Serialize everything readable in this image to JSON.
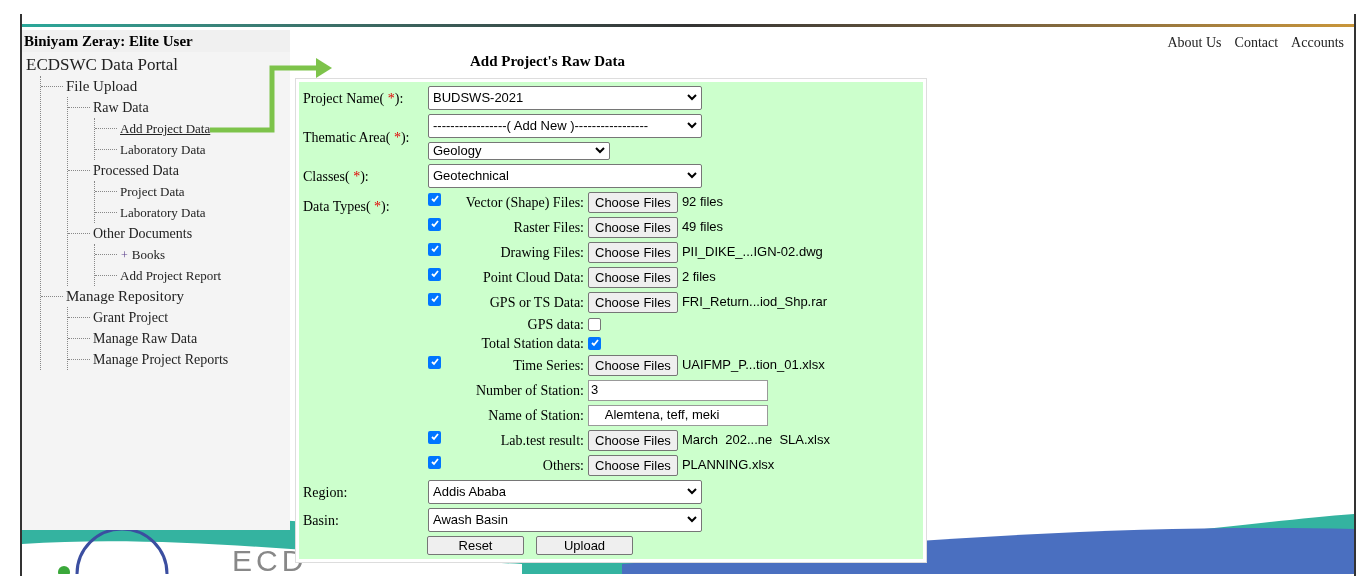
{
  "user": "Biniyam Zeray: Elite User",
  "top_links": [
    "About Us",
    "Contact",
    "Accounts"
  ],
  "tree": {
    "label": "ECDSWC Data Portal",
    "children": [
      {
        "label": "File Upload",
        "selected": false,
        "children": [
          {
            "label": "Raw Data",
            "selected": false,
            "children": [
              {
                "label": "Add Project Data",
                "selected": true
              },
              {
                "label": "Laboratory Data",
                "selected": false
              }
            ]
          },
          {
            "label": "Processed Data",
            "selected": false,
            "children": [
              {
                "label": "Project Data",
                "selected": false
              },
              {
                "label": "Laboratory Data",
                "selected": false
              }
            ]
          },
          {
            "label": "Other Documents",
            "selected": false,
            "children": [
              {
                "label": "Books",
                "selected": false,
                "expander": "+"
              },
              {
                "label": "Add Project Report",
                "selected": false
              }
            ]
          }
        ]
      },
      {
        "label": "Manage Repository",
        "selected": false,
        "children": [
          {
            "label": "Grant Project",
            "selected": false
          },
          {
            "label": "Manage Raw Data",
            "selected": false
          },
          {
            "label": "Manage Project Reports",
            "selected": false
          }
        ]
      }
    ]
  },
  "form": {
    "title": "Add Project's Raw Data",
    "project_name": {
      "label": "Project Name(",
      "required": "*",
      "label_end": "):",
      "value": "BUDSWS-2021"
    },
    "thematic_area": {
      "label": "Thematic Area(",
      "required": "*",
      "label_end": "):",
      "value": "-----------------( Add New )-----------------",
      "sub_value": "Geology"
    },
    "classes": {
      "label": "Classes(",
      "required": "*",
      "label_end": "):",
      "value": "Geotechnical"
    },
    "data_types": {
      "label": "Data Types(",
      "required": "*",
      "label_end": "):",
      "items": [
        {
          "kind": "file",
          "checked": true,
          "label": "Vector (Shape) Files:",
          "button": "Choose Files",
          "file": "92 files"
        },
        {
          "kind": "file",
          "checked": true,
          "label": "Raster Files:",
          "button": "Choose Files",
          "file": "49 files"
        },
        {
          "kind": "file",
          "checked": true,
          "label": "Drawing Files:",
          "button": "Choose Files",
          "file": "PII_DIKE_...IGN-02.dwg"
        },
        {
          "kind": "file",
          "checked": true,
          "label": "Point Cloud Data:",
          "button": "Choose Files",
          "file": "2 files"
        },
        {
          "kind": "file",
          "checked": true,
          "label": "GPS or TS Data:",
          "button": "Choose Files",
          "file": "FRI_Return...iod_Shp.rar"
        },
        {
          "kind": "check",
          "checked": false,
          "label": "GPS data:"
        },
        {
          "kind": "check",
          "checked": true,
          "label": "Total Station data:"
        },
        {
          "kind": "file",
          "checked": true,
          "label": "Time Series:",
          "button": "Choose Files",
          "file": "UAIFMP_P...tion_01.xlsx"
        },
        {
          "kind": "text",
          "label": "Number of Station:",
          "value": "3"
        },
        {
          "kind": "text",
          "label": "Name of Station:",
          "value": "    Alemtena, teff, meki"
        },
        {
          "kind": "file",
          "checked": true,
          "label": "Lab.test result:",
          "button": "Choose Files",
          "file": "March  202...ne  SLA.xlsx"
        },
        {
          "kind": "file",
          "checked": true,
          "label": "Others:",
          "button": "Choose Files",
          "file": "PLANNING.xlsx"
        }
      ]
    },
    "region": {
      "label": "Region:",
      "value": "Addis Ababa"
    },
    "basin": {
      "label": "Basin:",
      "value": "Awash Basin"
    },
    "buttons": [
      "Reset",
      "Upload"
    ]
  },
  "banner_text": "ECD"
}
